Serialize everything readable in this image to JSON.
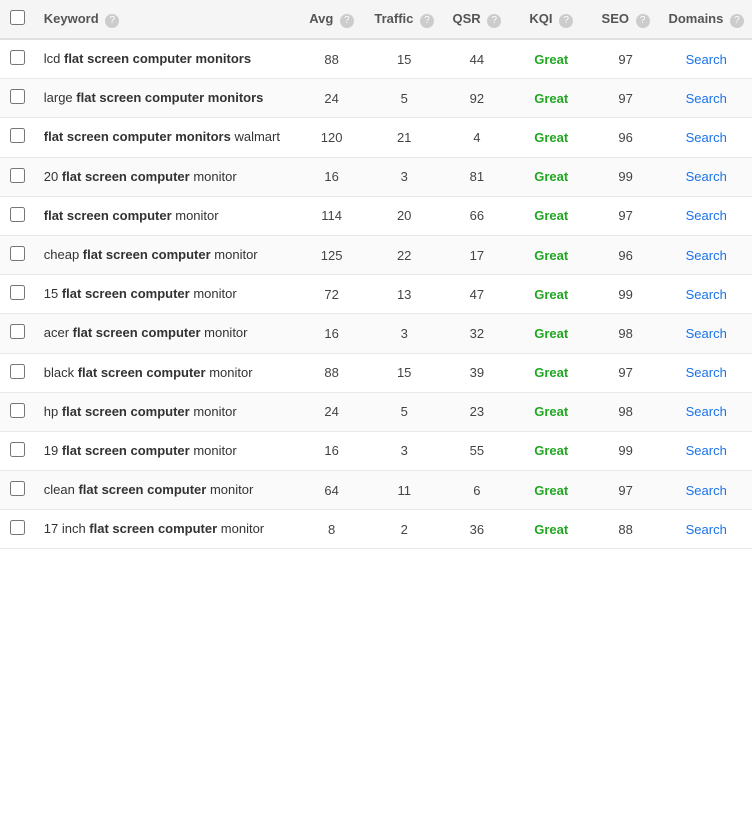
{
  "table": {
    "columns": [
      {
        "id": "checkbox",
        "label": ""
      },
      {
        "id": "keyword",
        "label": "Keyword",
        "hasInfo": true
      },
      {
        "id": "avg",
        "label": "Avg",
        "hasInfo": true
      },
      {
        "id": "traffic",
        "label": "Traffic",
        "hasInfo": true
      },
      {
        "id": "qsr",
        "label": "QSR",
        "hasInfo": true
      },
      {
        "id": "kqi",
        "label": "KQI",
        "hasInfo": true
      },
      {
        "id": "seo",
        "label": "SEO",
        "hasInfo": true
      },
      {
        "id": "domains",
        "label": "Domains",
        "hasInfo": true
      }
    ],
    "rows": [
      {
        "id": 1,
        "keyword_normal": "lcd ",
        "keyword_bold": "flat screen computer monitors",
        "keyword_suffix": "",
        "avg": "88",
        "traffic": "15",
        "qsr": "44",
        "kqi": "Great",
        "seo": "97",
        "domains": "Search"
      },
      {
        "id": 2,
        "keyword_normal": "large ",
        "keyword_bold": "flat screen computer monitors",
        "keyword_suffix": "",
        "avg": "24",
        "traffic": "5",
        "qsr": "92",
        "kqi": "Great",
        "seo": "97",
        "domains": "Search"
      },
      {
        "id": 3,
        "keyword_normal": "",
        "keyword_bold": "flat screen computer monitors",
        "keyword_suffix": " walmart",
        "avg": "120",
        "traffic": "21",
        "qsr": "4",
        "kqi": "Great",
        "seo": "96",
        "domains": "Search"
      },
      {
        "id": 4,
        "keyword_normal": "20 ",
        "keyword_bold": "flat screen computer",
        "keyword_suffix": " monitor",
        "avg": "16",
        "traffic": "3",
        "qsr": "81",
        "kqi": "Great",
        "seo": "99",
        "domains": "Search"
      },
      {
        "id": 5,
        "keyword_normal": "",
        "keyword_bold": "flat screen computer",
        "keyword_suffix": " monitor",
        "avg": "114",
        "traffic": "20",
        "qsr": "66",
        "kqi": "Great",
        "seo": "97",
        "domains": "Search"
      },
      {
        "id": 6,
        "keyword_normal": "cheap ",
        "keyword_bold": "flat screen computer",
        "keyword_suffix": " monitor",
        "avg": "125",
        "traffic": "22",
        "qsr": "17",
        "kqi": "Great",
        "seo": "96",
        "domains": "Search"
      },
      {
        "id": 7,
        "keyword_normal": "15 ",
        "keyword_bold": "flat screen computer",
        "keyword_suffix": " monitor",
        "avg": "72",
        "traffic": "13",
        "qsr": "47",
        "kqi": "Great",
        "seo": "99",
        "domains": "Search"
      },
      {
        "id": 8,
        "keyword_normal": "acer ",
        "keyword_bold": "flat screen computer",
        "keyword_suffix": " monitor",
        "avg": "16",
        "traffic": "3",
        "qsr": "32",
        "kqi": "Great",
        "seo": "98",
        "domains": "Search"
      },
      {
        "id": 9,
        "keyword_normal": "black ",
        "keyword_bold": "flat screen computer",
        "keyword_suffix": " monitor",
        "avg": "88",
        "traffic": "15",
        "qsr": "39",
        "kqi": "Great",
        "seo": "97",
        "domains": "Search"
      },
      {
        "id": 10,
        "keyword_normal": "hp ",
        "keyword_bold": "flat screen computer",
        "keyword_suffix": " monitor",
        "avg": "24",
        "traffic": "5",
        "qsr": "23",
        "kqi": "Great",
        "seo": "98",
        "domains": "Search"
      },
      {
        "id": 11,
        "keyword_normal": "19 ",
        "keyword_bold": "flat screen computer",
        "keyword_suffix": " monitor",
        "avg": "16",
        "traffic": "3",
        "qsr": "55",
        "kqi": "Great",
        "seo": "99",
        "domains": "Search"
      },
      {
        "id": 12,
        "keyword_normal": "clean ",
        "keyword_bold": "flat screen computer",
        "keyword_suffix": " monitor",
        "avg": "64",
        "traffic": "11",
        "qsr": "6",
        "kqi": "Great",
        "seo": "97",
        "domains": "Search"
      },
      {
        "id": 13,
        "keyword_normal": "17 inch ",
        "keyword_bold": "flat screen computer",
        "keyword_suffix": " monitor",
        "avg": "8",
        "traffic": "2",
        "qsr": "36",
        "kqi": "Great",
        "seo": "88",
        "domains": "Search"
      }
    ]
  }
}
